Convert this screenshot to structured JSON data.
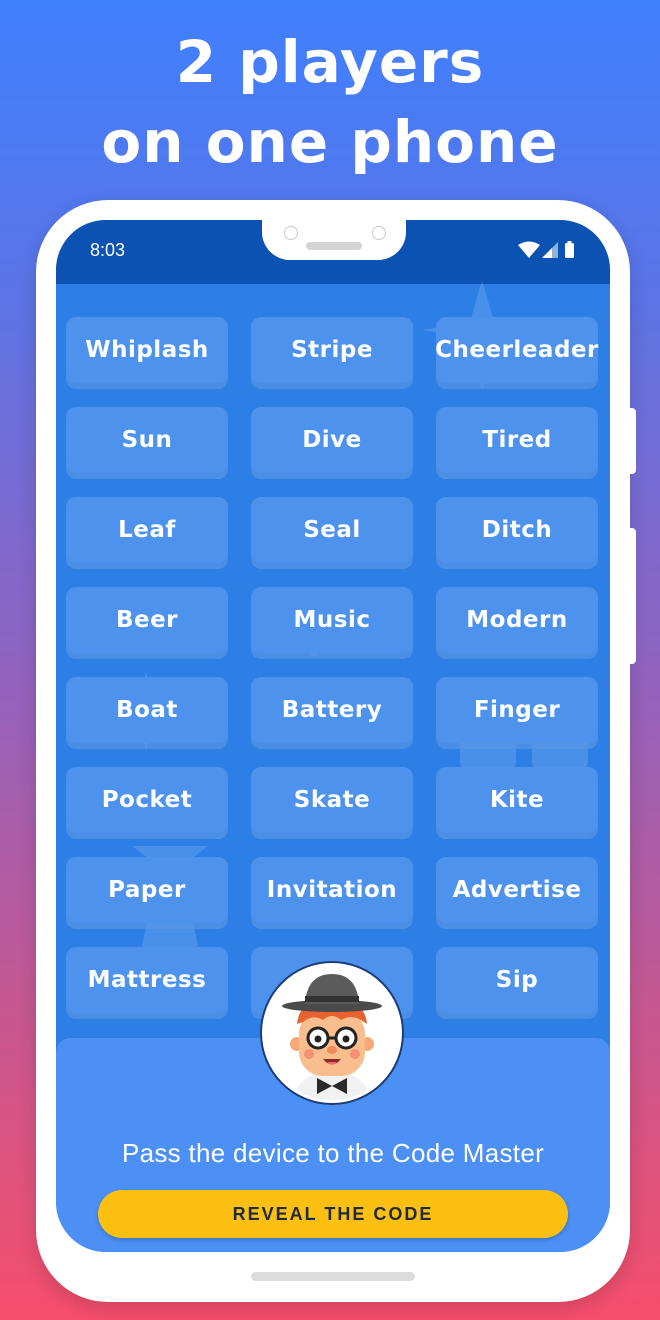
{
  "headline": {
    "line1": "2 players",
    "line2": "on one phone"
  },
  "status_bar": {
    "time": "8:03",
    "icons": [
      "wifi-icon",
      "signal-icon",
      "battery-icon"
    ]
  },
  "words": [
    "Whiplash",
    "Stripe",
    "Cheerleader",
    "Sun",
    "Dive",
    "Tired",
    "Leaf",
    "Seal",
    "Ditch",
    "Beer",
    "Music",
    "Modern",
    "Boat",
    "Battery",
    "Finger",
    "Pocket",
    "Skate",
    "Kite",
    "Paper",
    "Invitation",
    "Advertise",
    "Mattress",
    "",
    "Sip"
  ],
  "panel": {
    "prompt": "Pass the device to the Code Master",
    "button_label": "REVEAL THE CODE"
  },
  "colors": {
    "accent_button": "#fdc010",
    "screen_bg": "#2d7fe6",
    "tile": "#4d92ec",
    "status_bar": "#0c52b3"
  }
}
